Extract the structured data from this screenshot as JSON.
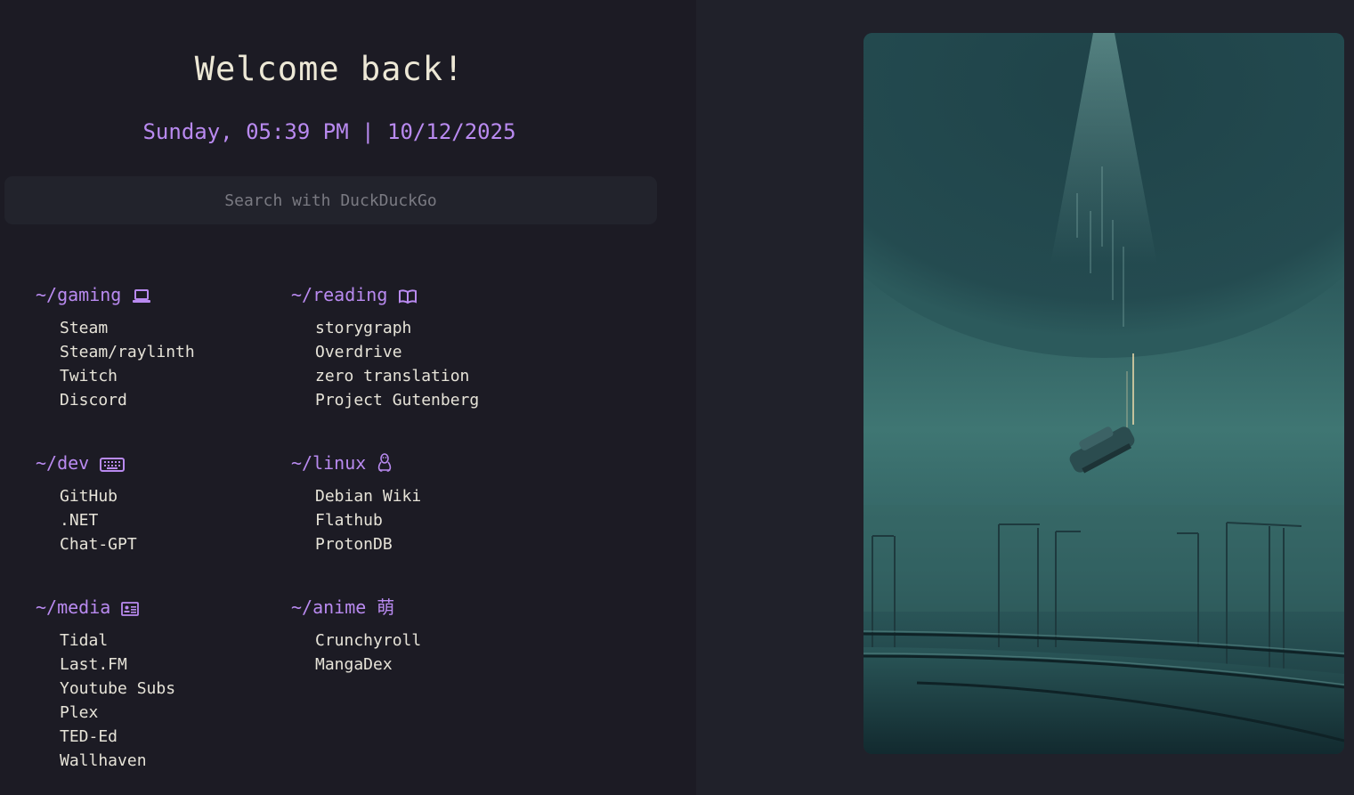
{
  "header": {
    "title": "Welcome back!",
    "datetime": "Sunday, 05:39 PM | 10/12/2025"
  },
  "search": {
    "placeholder": "Search with DuckDuckGo",
    "value": ""
  },
  "groups": [
    {
      "title": "~/gaming",
      "icon": "laptop-icon",
      "links": [
        "Steam",
        "Steam/raylinth",
        "Twitch",
        "Discord"
      ]
    },
    {
      "title": "~/reading",
      "icon": "book-icon",
      "links": [
        "storygraph",
        "Overdrive",
        "zero translation",
        "Project Gutenberg"
      ]
    },
    {
      "title": "~/dev",
      "icon": "keyboard-icon",
      "links": [
        "GitHub",
        ".NET",
        "Chat-GPT"
      ]
    },
    {
      "title": "~/linux",
      "icon": "penguin-icon",
      "links": [
        "Debian Wiki",
        "Flathub",
        "ProtonDB"
      ]
    },
    {
      "title": "~/media",
      "icon": "media-card-icon",
      "links": [
        "Tidal",
        "Last.FM",
        "Youtube Subs",
        "Plex",
        "TED-Ed",
        "Wallhaven"
      ]
    },
    {
      "title": "~/anime",
      "icon": "moe-kanji-icon",
      "icon_text": "萌",
      "links": [
        "Crunchyroll",
        "MangaDex"
      ]
    }
  ],
  "colors": {
    "accent": "#b98af0",
    "text": "#e6e3d8",
    "background": "#1c1b24",
    "panel": "#20212a"
  },
  "wallpaper": {
    "subject": "car-falling-from-sky-over-highway"
  }
}
